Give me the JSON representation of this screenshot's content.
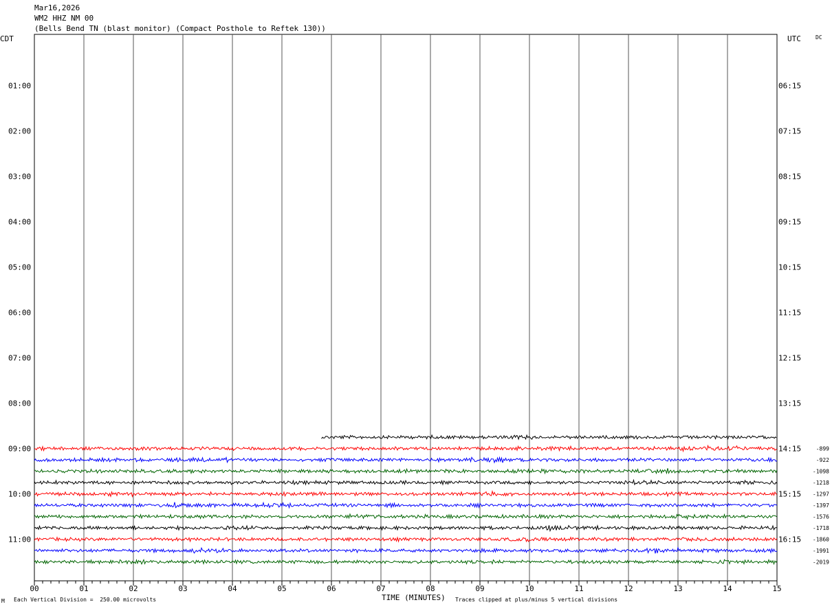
{
  "header": {
    "date": "Mar16,2026",
    "station": "WM2 HHZ NM 00",
    "description": "(Bells Bend TN (blast monitor) (Compact Posthole to Reftek 130))"
  },
  "left_tz": "CDT",
  "right_tz": "UTC",
  "corner_label": "DC",
  "footer": {
    "left_mark": "M",
    "division": "Each Vertical Division =  250.00 microvolts",
    "xlabel": "TIME (MINUTES)",
    "clip_note": "Traces clipped at plus/minus 5 vertical divisions"
  },
  "chart_data": {
    "type": "line",
    "x_ticks": [
      "00",
      "01",
      "02",
      "03",
      "04",
      "05",
      "06",
      "07",
      "08",
      "09",
      "10",
      "11",
      "12",
      "13",
      "14",
      "15"
    ],
    "xlim": [
      0,
      15
    ],
    "left_hours": [
      "01:00",
      "02:00",
      "03:00",
      "04:00",
      "05:00",
      "06:00",
      "07:00",
      "08:00",
      "09:00",
      "10:00",
      "11:00"
    ],
    "right_hours": [
      "06:15",
      "07:15",
      "08:15",
      "09:15",
      "10:15",
      "11:15",
      "12:15",
      "13:15",
      "14:15",
      "15:15",
      "16:15"
    ],
    "colors": [
      "#000000",
      "#ff0000",
      "#0000ff",
      "#006400"
    ],
    "traces": [
      {
        "row": 35,
        "color": "#000000",
        "start_min": 5.8,
        "end_min": 15,
        "offset": ""
      },
      {
        "row": 36,
        "color": "#ff0000",
        "start_min": 0,
        "end_min": 15,
        "offset": "-899"
      },
      {
        "row": 37,
        "color": "#0000ff",
        "start_min": 0,
        "end_min": 15,
        "offset": "-922"
      },
      {
        "row": 38,
        "color": "#006400",
        "start_min": 0,
        "end_min": 15,
        "offset": "-1098"
      },
      {
        "row": 39,
        "color": "#000000",
        "start_min": 0,
        "end_min": 15,
        "offset": "-1218"
      },
      {
        "row": 40,
        "color": "#ff0000",
        "start_min": 0,
        "end_min": 15,
        "offset": "-1297"
      },
      {
        "row": 41,
        "color": "#0000ff",
        "start_min": 0,
        "end_min": 15,
        "offset": "-1397"
      },
      {
        "row": 42,
        "color": "#006400",
        "start_min": 0,
        "end_min": 15,
        "offset": "-1576"
      },
      {
        "row": 43,
        "color": "#000000",
        "start_min": 0,
        "end_min": 15,
        "offset": "-1718"
      },
      {
        "row": 44,
        "color": "#ff0000",
        "start_min": 0,
        "end_min": 15,
        "offset": "-1860"
      },
      {
        "row": 45,
        "color": "#0000ff",
        "start_min": 0,
        "end_min": 15,
        "offset": "-1991"
      },
      {
        "row": 46,
        "color": "#006400",
        "start_min": 0,
        "end_min": 15,
        "offset": "-2019"
      }
    ],
    "grid": true
  }
}
